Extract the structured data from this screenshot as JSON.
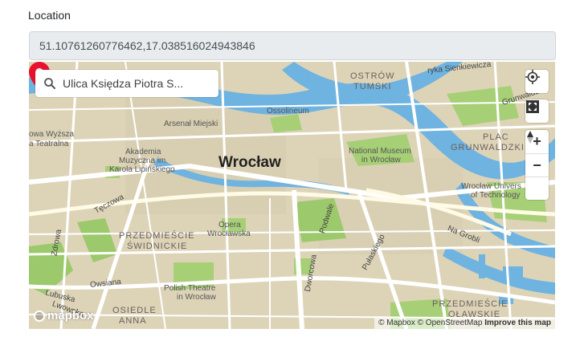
{
  "form": {
    "location_label": "Location",
    "coordinates_value": "51.10761260776462,17.038516024943846"
  },
  "map": {
    "search_text": "Ulica Księdza Piotra S...",
    "city_label": "Wrocław",
    "district_labels": {
      "ostrow_tumski_1": "OSTRÓW",
      "ostrow_tumski_2": "TUMSKI",
      "plac_grunwaldzki_1": "PLAC",
      "plac_grunwaldzki_2": "GRUNWALDZKI",
      "przedmiescie_swidnickie_1": "PRZEDMIEŚCIE",
      "przedmiescie_swidnickie_2": "ŚWIDNICKIE",
      "przedmiescie_olawskie_1": "PRZEDMIEŚCIE",
      "przedmiescie_olawskie_2": "OŁAWSKIE",
      "osiedle_1": "OSIEDLE",
      "osiedle_2": "ANNA"
    },
    "poi_labels": {
      "ossolineum": "Ossolineum",
      "arsenal": "Arsenał Miejski",
      "akademia_1": "Akademia",
      "akademia_2": "Muzyczna im.",
      "akademia_3": "Karola Lipińskiego",
      "national_museum_1": "National Museum",
      "national_museum_2": "in Wrocław",
      "opera_1": "Opera",
      "opera_2": "Wrocławska",
      "polish_theatre_1": "Polish Theatre",
      "polish_theatre_2": "in Wrocław",
      "university_1": "Wrocław Univers",
      "university_2": "of Technology",
      "wyzsza_1": "owa Wyższa",
      "wyzsza_2": "a Teatralna"
    },
    "road_labels": {
      "sienkiewicza": "ryka Sienkiewicza",
      "grunwaldzka": "Grunwaldzk",
      "na_grobli": "Na Grobli",
      "teczowa": "Tęczowa",
      "zrodlowa": "Zdrowa",
      "owsiana": "Owsiana",
      "lubuska": "Lubuska",
      "lwowska": "Lwowska",
      "dworcowa": "Dworcowa",
      "podwale": "Podwale",
      "pulaskiego": "Pułaskiego"
    },
    "logo_text": "mapbox",
    "attribution": {
      "mapbox": "© Mapbox",
      "osm": "© OpenStreetMap",
      "improve": "Improve this map"
    },
    "controls": {
      "geolocate_icon": "crosshair-icon",
      "fullscreen_icon": "fullscreen-icon",
      "zoom_in": "+",
      "zoom_out": "−",
      "compass_icon": "compass-icon"
    },
    "colors": {
      "land": "#ddd4b8",
      "water": "#6fb3e0",
      "park": "#9cc96b",
      "road": "#ffffff",
      "marker": "#e8112d"
    }
  }
}
